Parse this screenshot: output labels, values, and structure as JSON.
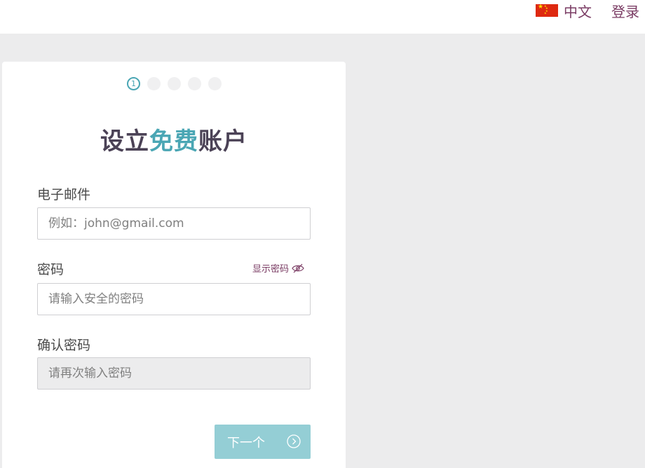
{
  "header": {
    "language_label": "中文",
    "login_label": "登录",
    "flag_icon": "china-flag-icon"
  },
  "signup": {
    "steps": [
      "1",
      "",
      "",
      "",
      ""
    ],
    "active_step": 1,
    "title_part1": "设立",
    "title_part2": "免费",
    "title_part3": "账户",
    "email_label": "电子邮件",
    "email_placeholder": "例如：john@gmail.com",
    "password_label": "密码",
    "show_password_label": "显示密码",
    "password_placeholder": "请输入安全的密码",
    "confirm_label": "确认密码",
    "confirm_placeholder": "请再次输入密码",
    "next_label": "下一个"
  },
  "colors": {
    "accent_teal": "#4aa6b4",
    "brand_purple": "#7a3b63",
    "title_dark": "#4b4256",
    "button_bg": "#94ced5"
  }
}
